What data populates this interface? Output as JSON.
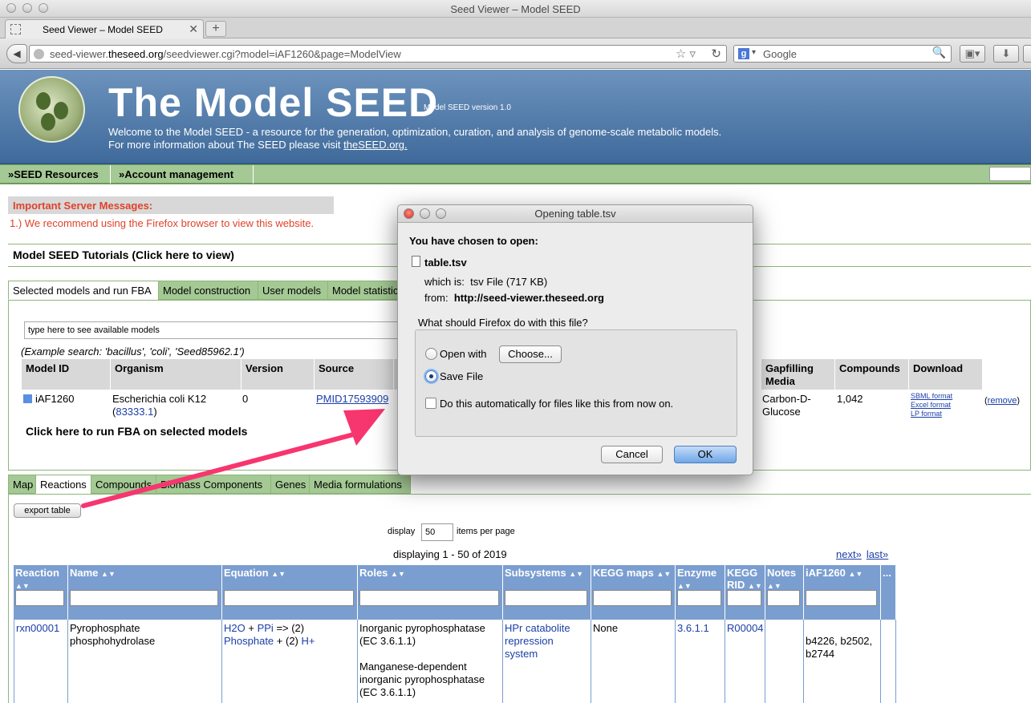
{
  "window": {
    "title": "Seed Viewer – Model SEED"
  },
  "browser": {
    "tab_label": "Seed Viewer – Model SEED",
    "new_tab": "+",
    "url_prefix": "seed-viewer.",
    "url_domain": "theseed.org",
    "url_rest": "/seedviewer.cgi?model=iAF1260&page=ModelView",
    "search_placeholder": "Google"
  },
  "header": {
    "title": "The Model SEED",
    "version": "Model SEED version 1.0",
    "welcome_line1": "Welcome to the Model SEED - a resource for the generation, optimization, curation, and analysis of genome-scale metabolic models.",
    "welcome_line2": "For more information about The SEED please visit ",
    "welcome_link": "theSEED.org."
  },
  "menu": {
    "items": [
      "»SEED Resources",
      "»Account management"
    ]
  },
  "messages": {
    "heading": "Important Server Messages:",
    "line1": "1.) We recommend using the Firefox browser to view this website."
  },
  "tutorials": "Model SEED Tutorials (Click here to view)",
  "model_tabs": [
    "Selected models and run FBA",
    "Model construction",
    "User models",
    "Model statistics"
  ],
  "model_search_placeholder": "type here to see available models",
  "example_search": "(Example search: 'bacillus', 'coli', 'Seed85962.1')",
  "models_table": {
    "headers": [
      "Model ID",
      "Organism",
      "Version",
      "Source",
      "Gapfilling Media",
      "Compounds",
      "Download"
    ],
    "row": {
      "id": "iAF1260",
      "organism": "Escherichia coli K12",
      "organism_id": "83333.1",
      "version": "0",
      "source": "PMID17593909",
      "media": "Carbon-D-Glucose",
      "compounds": "1,042",
      "downloads": [
        "SBML format",
        "Excel format",
        "LP format"
      ],
      "remove": "remove"
    }
  },
  "run_fba": "Click here to run FBA on selected models",
  "data_tabs": [
    "Map",
    "Reactions",
    "Compounds",
    "Biomass Components",
    "Genes",
    "Media formulations"
  ],
  "export_label": "export table",
  "pager": {
    "display_label": "display",
    "per_page_value": "50",
    "per_page_label": "items per page",
    "displaying": "displaying 1 - 50 of 2019",
    "next": "next»",
    "last": "last»"
  },
  "reactions_table": {
    "headers": [
      "Reaction",
      "Name",
      "Equation",
      "Roles",
      "Subsystems",
      "KEGG maps",
      "Enzyme",
      "KEGG RID",
      "Notes",
      "iAF1260",
      "..."
    ],
    "row": {
      "reaction": "rxn00001",
      "name": "Pyrophosphate phosphohydrolase",
      "equation_parts": [
        "H2O",
        "+",
        "PPi",
        "=> (2)",
        "Phosphate",
        "+ (2)",
        "H+"
      ],
      "roles1": "Inorganic pyrophosphatase (EC 3.6.1.1)",
      "roles2": "Manganese-dependent inorganic pyrophosphatase (EC 3.6.1.1)",
      "subsystem": "HPr catabolite repression system",
      "kegg_maps": "None",
      "enzyme": "3.6.1.1",
      "kegg_rid": "R00004",
      "genes": "b4226, b2502, b2744"
    }
  },
  "dialog": {
    "title": "Opening table.tsv",
    "chosen": "You have chosen to open:",
    "filename": "table.tsv",
    "which_is_label": "which is:",
    "which_is_value": "tsv File (717 KB)",
    "from_label": "from:",
    "from_value": "http://seed-viewer.theseed.org",
    "question": "What should Firefox do with this file?",
    "open_with": "Open with",
    "choose": "Choose...",
    "save_file": "Save File",
    "auto": "Do this automatically for files like this from now on.",
    "cancel": "Cancel",
    "ok": "OK",
    "selected_option": "save_file"
  },
  "colors": {
    "header_blue": "#4f78a8",
    "menu_green": "#a4c994",
    "alert_red": "#e0422a",
    "table_blue": "#7a9ed0",
    "arrow_pink": "#f7356f"
  }
}
